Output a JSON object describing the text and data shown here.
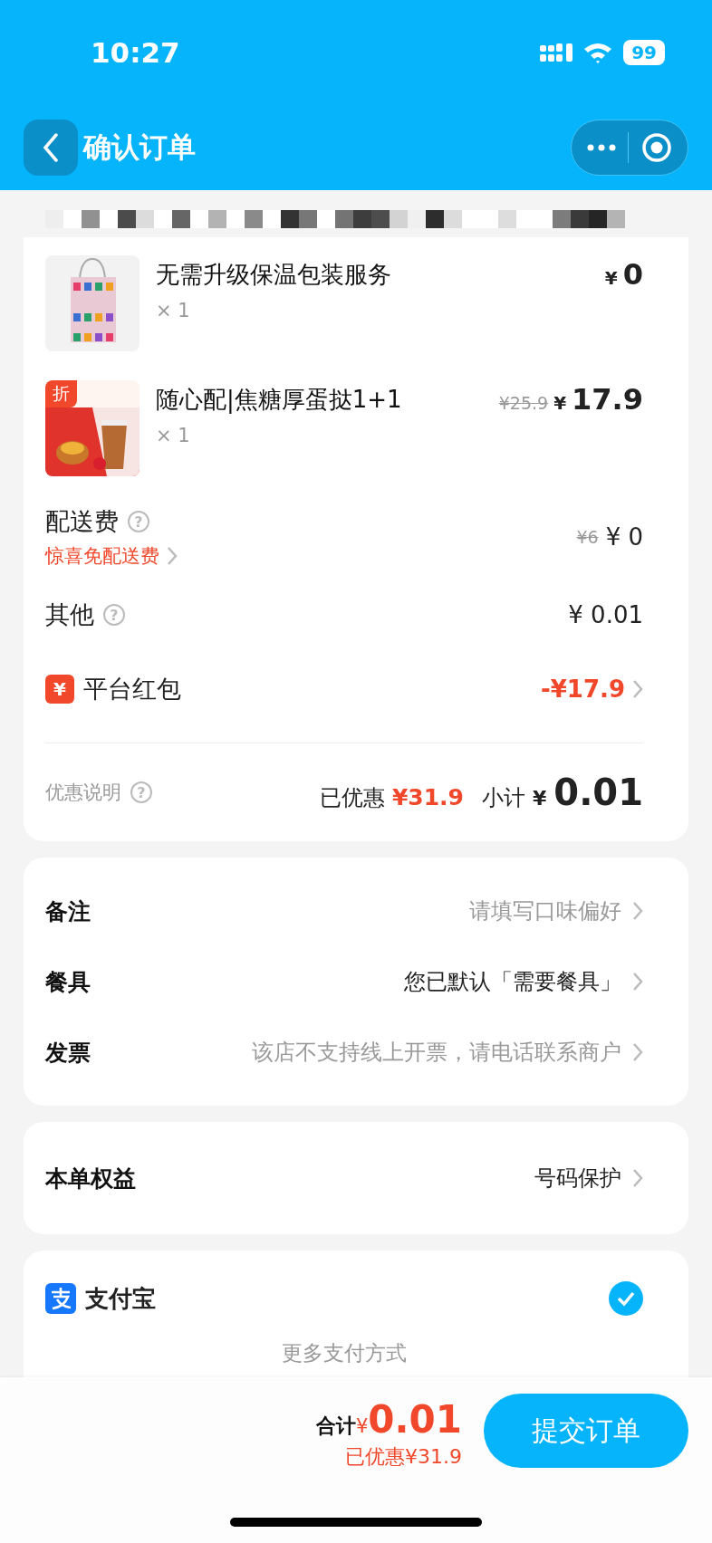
{
  "status_bar": {
    "time": "10:27",
    "battery": "99"
  },
  "nav": {
    "title": "确认订单"
  },
  "items": [
    {
      "kind": "bag",
      "name": "无需升级保温包装服务",
      "quantity": "× 1",
      "price_symbol": "¥",
      "price": "0"
    },
    {
      "kind": "combo",
      "badge": "折",
      "name": "随心配|焦糖厚蛋挞1+1",
      "quantity": "× 1",
      "original_price": "¥25.9",
      "price_symbol": "¥",
      "price": "17.9"
    }
  ],
  "fees": [
    {
      "kind": "delivery",
      "label": "配送费",
      "help": "?",
      "promo": "惊喜免配送费",
      "original_price": "¥6",
      "price": "¥ 0"
    },
    {
      "kind": "other",
      "label": "其他",
      "help": "?",
      "price": "¥ 0.01"
    },
    {
      "kind": "packet",
      "label": "平台红包",
      "icon": "¥",
      "price": "-¥17.9"
    }
  ],
  "summary": {
    "label": "优惠说明",
    "help": "?",
    "saved_label": "已优惠",
    "saved": "¥31.9",
    "subtotal_label": "小计",
    "subtotal_symbol": "¥",
    "subtotal": "0.01"
  },
  "options": [
    {
      "kind": "placeholder",
      "label": "备注",
      "value": "请填写口味偏好"
    },
    {
      "kind": "value",
      "label": "餐具",
      "value": "您已默认「需要餐具」"
    },
    {
      "kind": "placeholder",
      "label": "发票",
      "value": "该店不支持线上开票，请电话联系商户"
    }
  ],
  "benefits": {
    "label": "本单权益",
    "value": "号码保护"
  },
  "payment": {
    "methods": [
      {
        "name": "支付宝",
        "selected": true
      }
    ],
    "more": "更多支付方式"
  },
  "footer": {
    "total_label": "合计",
    "total_symbol": "¥",
    "total": "0.01",
    "saved": "已优惠¥31.9",
    "submit": "提交订单"
  }
}
